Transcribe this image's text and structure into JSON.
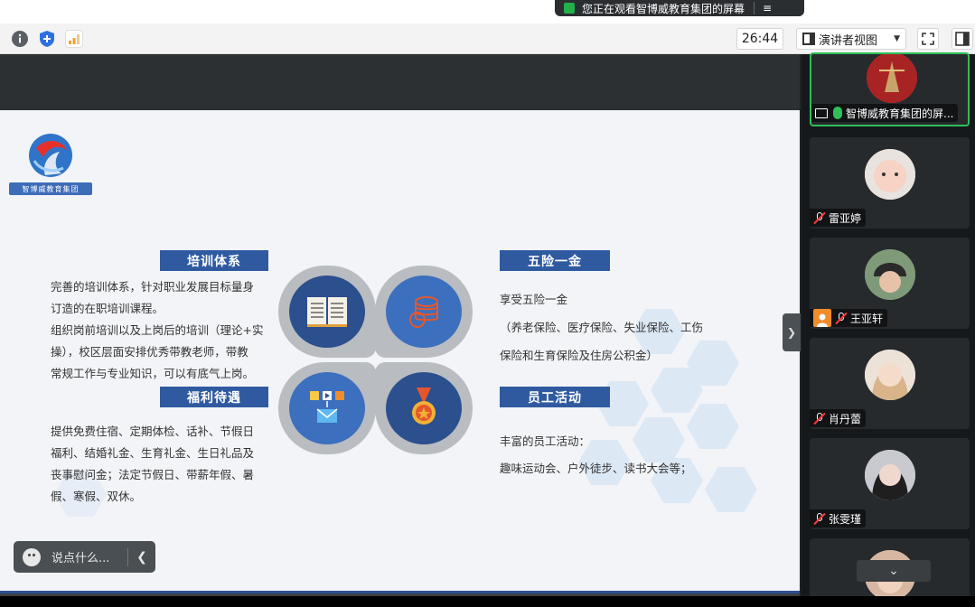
{
  "share_banner": {
    "text": "您正在观看智博威教育集团的屏幕",
    "menu_icon": "menu-lines-icon"
  },
  "toolbar": {
    "timer": "26:44",
    "view_mode": "演讲者视图",
    "icons": [
      "info-icon",
      "shield-icon",
      "signal-bars-icon",
      "fullscreen-icon",
      "sidebar-toggle-icon"
    ]
  },
  "slide": {
    "logo_text": "智博威教育集团",
    "sections": {
      "training": {
        "title": "培训体系",
        "lines": [
          "完善的培训体系，针对职业发展目标量身",
          "订造的在职培训课程。",
          "组织岗前培训以及上岗后的培训（理论+实",
          "操），校区层面安排优秀带教老师，带教",
          "常规工作与专业知识，可以有底气上岗。"
        ]
      },
      "welfare": {
        "title": "福利待遇",
        "lines": [
          "提供免费住宿、定期体检、话补、节假日",
          "福利、结婚礼金、生育礼金、生日礼品及",
          "丧事慰问金；法定节假日、带薪年假、暑",
          "假、寒假、双休。"
        ]
      },
      "insurance": {
        "title": "五险一金",
        "lines": [
          "享受五险一金",
          "（养老保险、医疗保险、失业保险、工伤",
          "保险和生育保险及住房公积金）"
        ]
      },
      "activities": {
        "title": "员工活动",
        "lines": [
          "丰富的员工活动：",
          "趣味运动会、户外徒步、读书大会等；"
        ]
      }
    }
  },
  "chat": {
    "placeholder": "说点什么..."
  },
  "participants": [
    {
      "name": "智博威教育集团的屏...",
      "active": true
    },
    {
      "name": "雷亚婷"
    },
    {
      "name": "王亚轩"
    },
    {
      "name": "肖丹蕾"
    },
    {
      "name": "张雯瑾"
    }
  ]
}
